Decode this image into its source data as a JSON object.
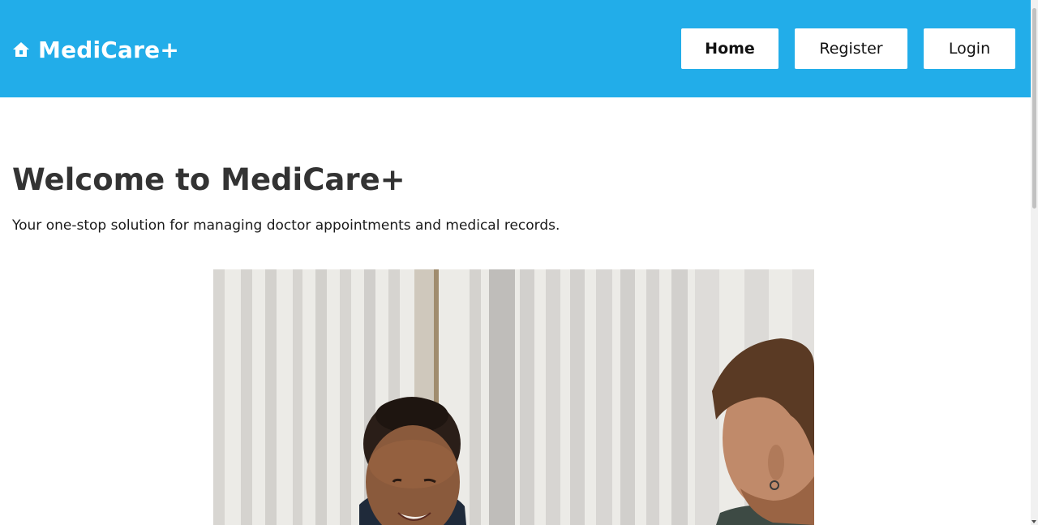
{
  "header": {
    "brand": {
      "icon": "home-icon",
      "name": "MediCare+"
    },
    "nav": [
      {
        "label": "Home",
        "active": true
      },
      {
        "label": "Register",
        "active": false
      },
      {
        "label": "Login",
        "active": false
      }
    ]
  },
  "hero": {
    "title": "Welcome to MediCare+",
    "subtitle": "Your one-stop solution for managing doctor appointments and medical records."
  },
  "colors": {
    "header_bg": "#22ade9",
    "text_primary": "#333333",
    "button_bg": "#ffffff"
  }
}
